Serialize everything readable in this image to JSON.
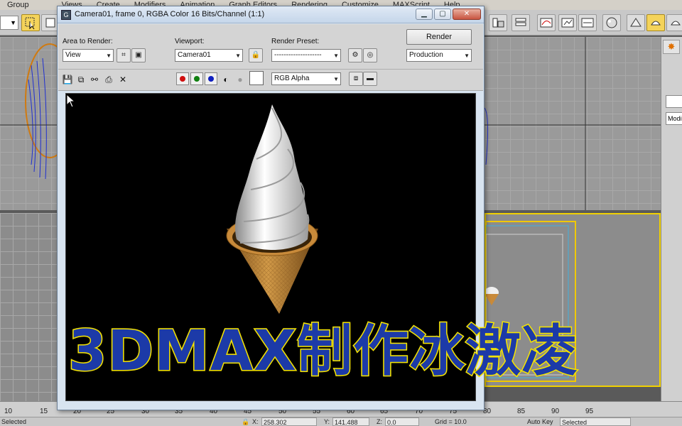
{
  "menu": [
    "Group",
    "Views",
    "Create",
    "Modifiers",
    "Animation",
    "Graph Editors",
    "Rendering",
    "Customize",
    "MAXScript",
    "Help"
  ],
  "render_window": {
    "title": "Camera01, frame 0, RGBA Color 16 Bits/Channel (1:1)",
    "area_to_render": {
      "label": "Area to Render:",
      "value": "View"
    },
    "viewport": {
      "label": "Viewport:",
      "value": "Camera01"
    },
    "render_preset": {
      "label": "Render Preset:",
      "value": "--------------------"
    },
    "render_button": "Render",
    "production": "Production",
    "channel_display": "RGB Alpha"
  },
  "overlay_title": "3DMAX制作冰激凌",
  "command_panel": {
    "modifier_field": "Modi"
  },
  "timeline": {
    "ticks": [
      "10",
      "15",
      "20",
      "25",
      "30",
      "35",
      "40",
      "45",
      "50",
      "55",
      "60",
      "65",
      "70",
      "75",
      "80",
      "85",
      "90",
      "95"
    ]
  },
  "status": {
    "left": "Selected",
    "x_value": "258.302",
    "y_value": "141.488",
    "z_value": "0.0",
    "grid": "Grid = 10.0",
    "auto_key": "Auto Key",
    "selected_dropdown": "Selected"
  },
  "colors": {
    "title_fill": "#1c3aa8",
    "title_stroke": "#f5e400",
    "cone": "#c88a3a",
    "cream": "#f2f2f2",
    "active_viewport": "#f0d000"
  }
}
